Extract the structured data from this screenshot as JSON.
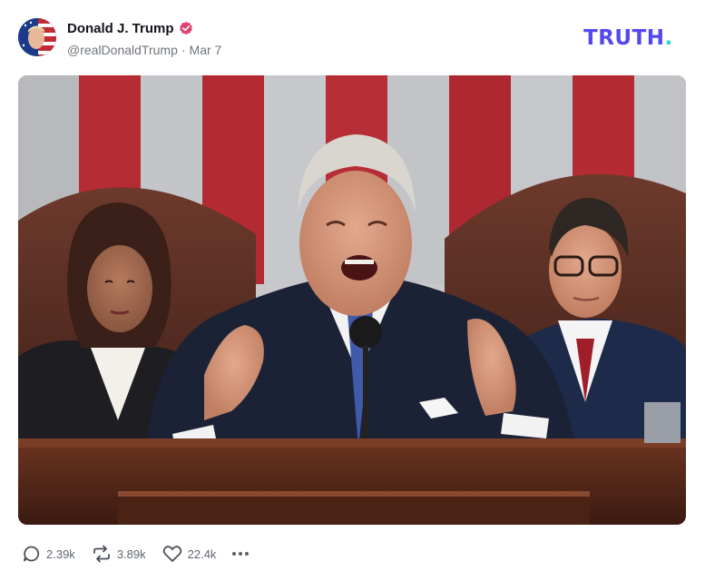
{
  "author": {
    "display_name": "Donald J. Trump",
    "handle": "@realDonaldTrump",
    "separator": "·",
    "date": "Mar 7",
    "verified": true,
    "avatar": "user-avatar"
  },
  "brand": {
    "logo_text": "TRUTH",
    "logo_dot": ".",
    "accent": "#5448ee",
    "dot_color": "#2fd6c6"
  },
  "media": {
    "icon": "photo"
  },
  "actions": {
    "replies": "2.39k",
    "retruths": "3.89k",
    "likes": "22.4k",
    "more": "more-options-icon"
  },
  "colors": {
    "verified_badge": "#e0426f",
    "muted_text": "#71767b"
  }
}
